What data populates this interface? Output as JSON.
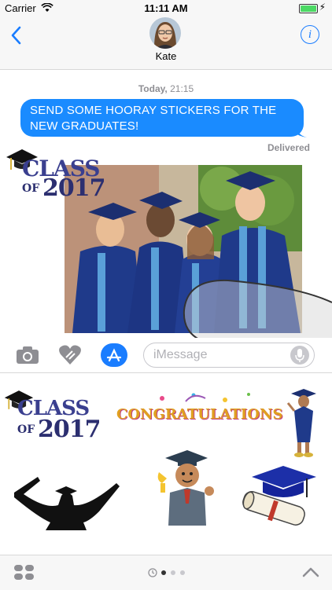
{
  "status_bar": {
    "carrier": "Carrier",
    "time": "11:11 AM"
  },
  "nav": {
    "contact_name": "Kate"
  },
  "conversation": {
    "timestamp_day": "Today,",
    "timestamp_time": "21:15",
    "message": "SEND SOME HOORAY STICKERS FOR THE NEW GRADUATES!",
    "delivery_status": "Delivered"
  },
  "stickers": {
    "class_of_line1": "CLASS",
    "class_of_line2a": "OF",
    "class_of_line2b": "2017",
    "congratulations": "CONGRATULATIONS"
  },
  "input": {
    "placeholder": "iMessage"
  },
  "colors": {
    "accent": "#1a7dff",
    "bubble": "#1a8bff",
    "gown": "#1f3a8a"
  },
  "icons": [
    "back-chevron-icon",
    "info-icon",
    "camera-icon",
    "digital-touch-heart-icon",
    "app-store-icon",
    "microphone-icon",
    "app-drawer-icon",
    "recents-icon",
    "chevron-up-icon"
  ]
}
